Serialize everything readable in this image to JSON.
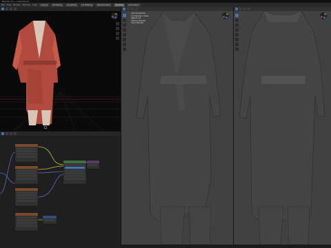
{
  "window": {
    "title": "Blender [C:\\...\\robe.blend]"
  },
  "menu": {
    "items": [
      "File",
      "Edit",
      "Render",
      "Window",
      "Help"
    ],
    "tabs": [
      "Layout",
      "Modeling",
      "Sculpting",
      "UV Editing",
      "Texture Paint",
      "Shading",
      "Animation"
    ],
    "active_tab": "Shading"
  },
  "viewports": {
    "main1": {
      "overlay_lines": [
        "User Perspective",
        "(1) Collection | Robe",
        "Objects 1/3",
        "Vertices 184,902",
        "Faces 183,640"
      ]
    },
    "main2": {
      "overlay_lines": []
    }
  },
  "colors": {
    "robe_main": "#b14a3e",
    "robe_light": "#d8c5b6",
    "clay": "#6e6e6e",
    "viewport_bg": "#414141",
    "accent": "#4772b3"
  },
  "icons": [
    "orientation-gizmo-icon",
    "zoom-icon",
    "pan-icon",
    "camera-icon",
    "grid-icon"
  ]
}
